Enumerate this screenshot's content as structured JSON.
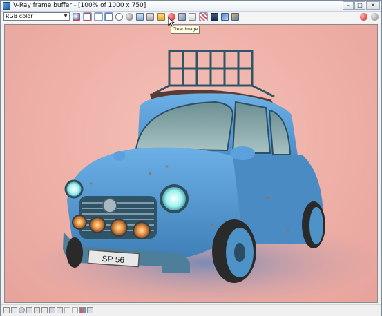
{
  "window": {
    "title": "V-Ray frame buffer - [100% of 1000 x 750]",
    "controls": [
      "minimize",
      "maximize",
      "close"
    ]
  },
  "toolbar": {
    "channel_select": {
      "value": "RGB color"
    },
    "buttons": [
      "save-image-icon",
      "stop-icon",
      "grayscale-icon",
      "mono-icon",
      "sphere-white-icon",
      "sphere-gray-icon",
      "duplicate-icon",
      "copy-icon",
      "open-folder-icon",
      "clear-image-icon",
      "region-icon",
      "history-icon",
      "lens-fx-icon",
      "color-correction-icon",
      "compare-icon",
      "render-icon",
      "stop-render-icon"
    ],
    "hover_tooltip": "Clear image"
  },
  "render": {
    "subject": "blue cartoon car with roof rack",
    "license_plate": "SP 56",
    "colors": {
      "background": "#eeb0a7",
      "car_body": "#4f95cf",
      "headlight": "#8fe6e3",
      "fog_light": "#e08a3a"
    }
  },
  "statusbar": {
    "icons": [
      "pixel-info-icon",
      "frame-icon",
      "gear-icon",
      "layers-icon",
      "curves-icon",
      "compare-ab-icon",
      "display-icon",
      "copy-region-icon",
      "flip-h-icon",
      "flip-v-icon",
      "swatch-icon",
      "compare-icon"
    ]
  }
}
